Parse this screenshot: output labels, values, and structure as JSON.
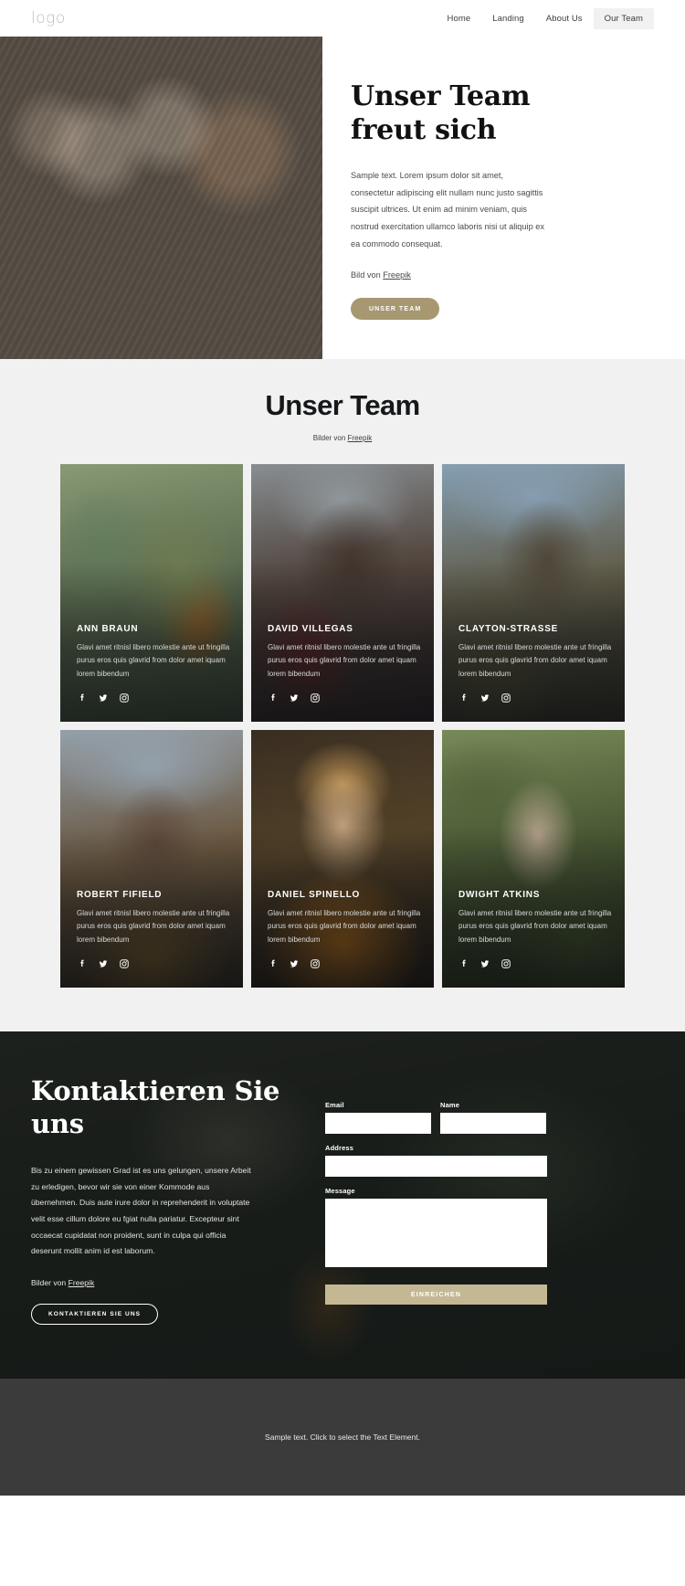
{
  "header": {
    "logo": "logo",
    "nav": [
      {
        "label": "Home",
        "active": false
      },
      {
        "label": "Landing",
        "active": false
      },
      {
        "label": "About Us",
        "active": false
      },
      {
        "label": "Our Team",
        "active": true
      }
    ]
  },
  "hero": {
    "title_line1": "Unser Team",
    "title_line2": "freut sich",
    "paragraph": "Sample text. Lorem ipsum dolor sit amet, consectetur adipiscing elit nullam nunc justo sagittis suscipit ultrices. Ut enim ad minim veniam, quis nostrud exercitation ullamco laboris nisi ut aliquip ex ea commodo consequat.",
    "credit_prefix": "Bild von ",
    "credit_link": "Freepik",
    "cta_label": "UNSER TEAM",
    "cta_color": "#a79871"
  },
  "team": {
    "title": "Unser Team",
    "sub_prefix": "Bilder von ",
    "sub_link": "Freepik",
    "card_description": "Glavi amet ritnisl libero molestie ante ut fringilla purus eros quis glavrid from dolor amet iquam lorem bibendum",
    "socials": [
      "facebook-icon",
      "twitter-icon",
      "instagram-icon"
    ],
    "members": [
      {
        "name": "ANN BRAUN"
      },
      {
        "name": "DAVID VILLEGAS"
      },
      {
        "name": "CLAYTON-STRASSE"
      },
      {
        "name": "ROBERT FIFIELD"
      },
      {
        "name": "DANIEL SPINELLO"
      },
      {
        "name": "DWIGHT ATKINS"
      }
    ]
  },
  "contact": {
    "title_line1": "Kontaktieren Sie",
    "title_line2": "uns",
    "paragraph": "Bis zu einem gewissen Grad ist es uns gelungen, unsere Arbeit zu erledigen, bevor wir sie von einer Kommode aus übernehmen. Duis aute irure dolor in reprehenderit in voluptate velit esse cillum dolore eu fgiat nulla pariatur. Excepteur sint occaecat cupidatat non proident, sunt in culpa qui officia deserunt mollit anim id est laborum.",
    "credit_prefix": "Bilder von ",
    "credit_link": "Freepik",
    "cta_label": "KONTAKTIEREN SIE UNS",
    "form": {
      "email_label": "Email",
      "email_value": "",
      "email_placeholder": "",
      "name_label": "Name",
      "name_value": "",
      "name_placeholder": "",
      "address_label": "Address",
      "address_value": "",
      "address_placeholder": "",
      "message_label": "Message",
      "message_value": "",
      "message_placeholder": "",
      "submit_label": "EINREICHEN",
      "submit_color": "#c4b793"
    }
  },
  "footer": {
    "text": "Sample text. Click to select the Text Element."
  }
}
